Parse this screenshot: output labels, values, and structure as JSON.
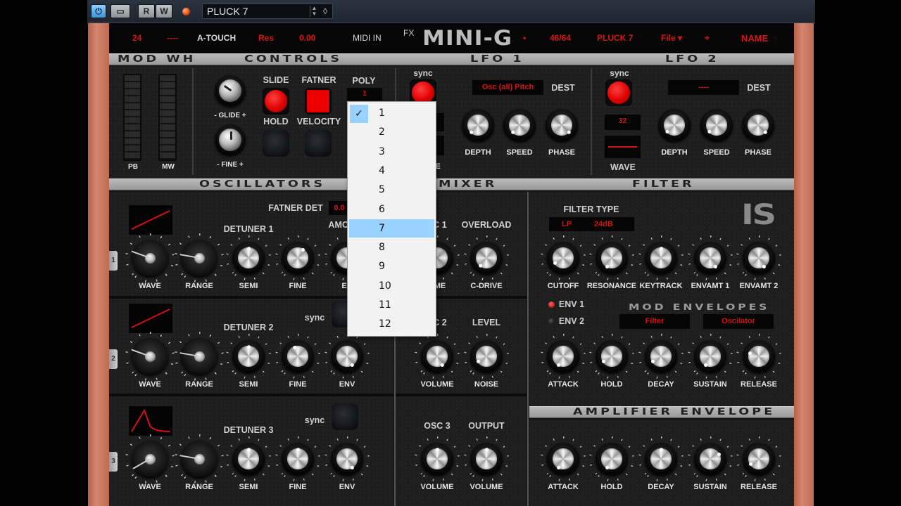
{
  "host": {
    "power_label": "⏻",
    "bypass_label": "▭",
    "read_label": "R",
    "write_label": "W",
    "preset_name": "PLUCK 7",
    "preset_arrows": "▲▼",
    "preset_menu_icon": "◊"
  },
  "topbar": {
    "value_24": "24",
    "dash": "----",
    "atouch": "A-TOUCH",
    "res": "Res",
    "res_value": "0.00",
    "midi_in": "MIDI IN",
    "fx": "FX",
    "logo": "MINI-G",
    "dot": "•",
    "preset_count": "46/64",
    "preset_name": "PLUCK 7",
    "file": "File ▾",
    "plus": "+",
    "name": "NAME"
  },
  "sections": {
    "mod_wh": "MOD WH",
    "controls": "CONTROLS",
    "lfo1": "LFO 1",
    "lfo2": "LFO 2",
    "oscillators": "OSCILLATORS",
    "mixer": "MIXER",
    "filter": "FILTER",
    "mod_envelopes": "MOD ENVELOPES",
    "amp_envelope": "AMPLIFIER ENVELOPE"
  },
  "modwh": {
    "pb": "PB",
    "mw": "MW"
  },
  "controls": {
    "glide": "- GLIDE +",
    "fine": "- FINE +",
    "slide": "SLIDE",
    "fatner": "FATNER",
    "hold": "HOLD",
    "velocity": "VELOCITY",
    "poly": "POLY",
    "poly_value": "1",
    "slide_on": true,
    "fatner_on": true,
    "hold_on": false,
    "velocity_on": false
  },
  "lfo1": {
    "sync": "sync",
    "dest_value": "Osc (all) Pitch",
    "dest": "DEST",
    "knobs": [
      "DEPTH",
      "SPEED",
      "PHASE"
    ],
    "wave_partial": "E"
  },
  "lfo2": {
    "sync": "sync",
    "dest_value": "----",
    "dest": "DEST",
    "rate_value": "32",
    "wave": "WAVE",
    "knobs": [
      "DEPTH",
      "SPEED",
      "PHASE"
    ]
  },
  "osc": {
    "fatner_det": "FATNER DET",
    "fatner_det_value": "0.0",
    "amount_partial": "AMO",
    "knob_labels": [
      "WAVE",
      "RANGE",
      "SEMI",
      "FINE",
      "ENV"
    ],
    "rows": [
      {
        "tab": "1",
        "detuner": "DETUNER 1",
        "sync": ""
      },
      {
        "tab": "2",
        "detuner": "DETUNER 2",
        "sync": "sync"
      },
      {
        "tab": "3",
        "detuner": "DETUNER 3",
        "sync": "sync"
      }
    ],
    "env_partial": "EN"
  },
  "mixer": {
    "osc1_partial": "C 1",
    "overload": "OVERLOAD",
    "volume_partial": "UME",
    "cdrive": "C-DRIVE",
    "osc2_partial": "C 2",
    "level": "LEVEL",
    "volume": "VOLUME",
    "noise": "NOISE",
    "osc3": "OSC 3",
    "output": "OUTPUT"
  },
  "filter": {
    "filter_type": "FILTER TYPE",
    "type_value": "LP",
    "slope_value": "24dB",
    "knobs": [
      "CUTOFF",
      "RESONANCE",
      "KEYTRACK",
      "ENVAMT 1",
      "ENVAMT 2"
    ],
    "logo": "IS"
  },
  "modenv": {
    "env1": "ENV 1",
    "env2": "ENV 2",
    "dest1": "Filter",
    "dest2": "Oscilator",
    "knobs": [
      "ATTACK",
      "HOLD",
      "DECAY",
      "SUSTAIN",
      "RELEASE"
    ]
  },
  "ampenv": {
    "knobs": [
      "ATTACK",
      "HOLD",
      "DECAY",
      "SUSTAIN",
      "RELEASE"
    ]
  },
  "poly_menu": {
    "checked": "1",
    "hovered": "7",
    "check_icon": "✓",
    "items": [
      "1",
      "2",
      "3",
      "4",
      "5",
      "6",
      "7",
      "8",
      "9",
      "10",
      "11",
      "12"
    ]
  },
  "colors": {
    "accent_red": "#d61515",
    "menu_highlight": "#99d1ff",
    "wood": "#c87460"
  }
}
